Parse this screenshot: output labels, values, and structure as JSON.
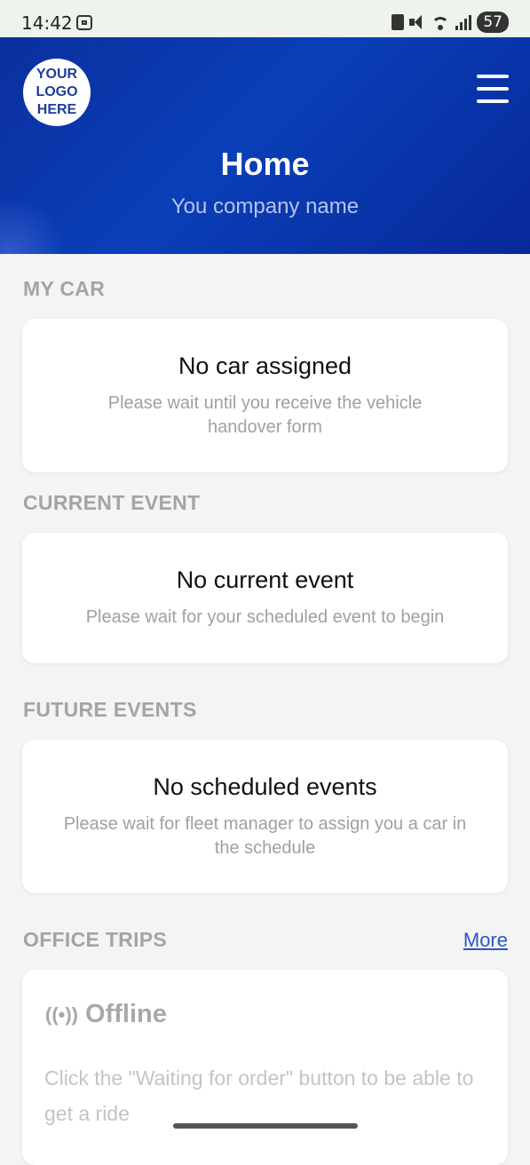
{
  "status_bar": {
    "time": "14:42",
    "battery": "57"
  },
  "header": {
    "logo_text": "YOUR LOGO HERE",
    "title": "Home",
    "company_name": "You company name"
  },
  "sections": {
    "my_car": {
      "label": "MY CAR",
      "card_title": "No car assigned",
      "card_desc": "Please wait until you receive the vehicle handover form"
    },
    "current_event": {
      "label": "CURRENT EVENT",
      "card_title": "No current event",
      "card_desc": "Please wait for your scheduled event to begin"
    },
    "future_events": {
      "label": "FUTURE EVENTS",
      "card_title": "No scheduled events",
      "card_desc": "Please wait for fleet manager to assign you a car in the schedule"
    },
    "office_trips": {
      "label": "OFFICE TRIPS",
      "more_label": "More",
      "status": "Offline",
      "status_icon": "broadcast-icon",
      "desc": "Click the \"Waiting for order\" button to be able to get a ride"
    }
  },
  "colors": {
    "header_blue": "#0a3fb8",
    "link_blue": "#2b56c6",
    "section_label": "#a4a4a4"
  }
}
